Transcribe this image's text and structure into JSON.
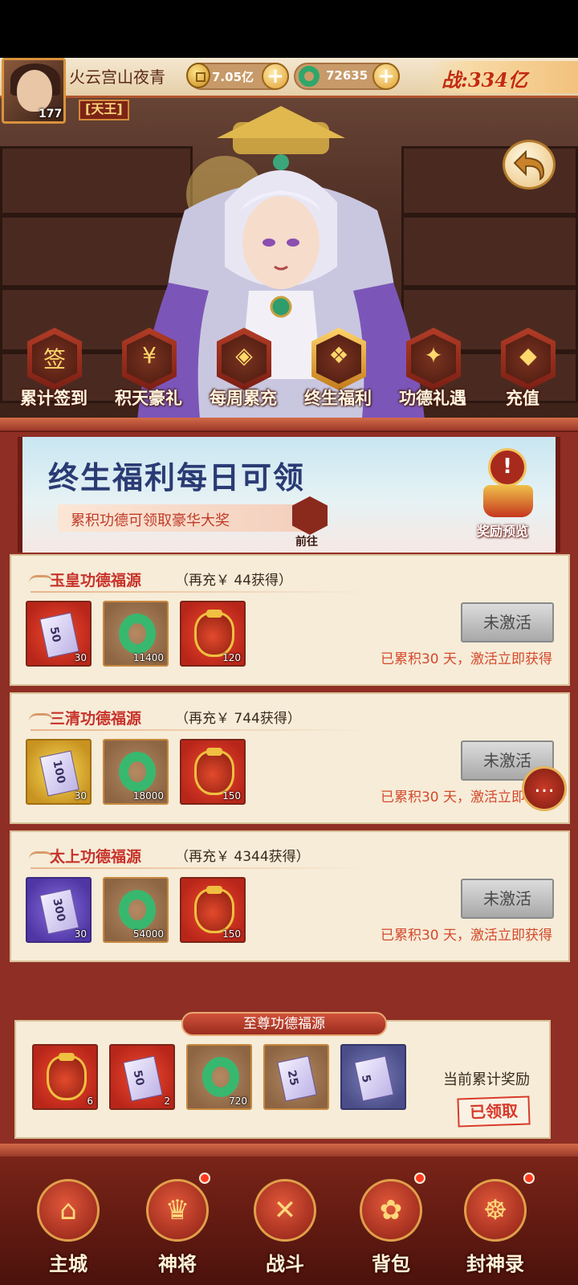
{
  "player": {
    "name": "火云宫山夜青",
    "level": "177",
    "title": "[天王]",
    "gold": "7.05亿",
    "jade": "72635",
    "power": "战:334亿"
  },
  "tabs": [
    {
      "label": "累计签到",
      "icon": "scroll-icon",
      "glyph": "签"
    },
    {
      "label": "积天豪礼",
      "icon": "coins-icon",
      "glyph": "¥"
    },
    {
      "label": "每周累充",
      "icon": "treasure-icon",
      "glyph": "◈"
    },
    {
      "label": "终生福利",
      "icon": "giftbox-icon",
      "glyph": "❖",
      "active": true
    },
    {
      "label": "功德礼遇",
      "icon": "gift-icon",
      "glyph": "✦"
    },
    {
      "label": "充值",
      "icon": "ingot-icon",
      "glyph": "◆"
    }
  ],
  "banner": {
    "title": "终生福利每日可领",
    "subtitle": "累积功德可领取豪华大奖",
    "go_label": "前往",
    "preview_label": "奖励预览"
  },
  "cards": [
    {
      "title": "玉皇功德福源",
      "note": "（再充￥ 44获得）",
      "items": [
        {
          "icon": "voucher-50-icon",
          "face": "50",
          "count": "30"
        },
        {
          "icon": "jade-ring-icon",
          "count": "11400"
        },
        {
          "icon": "red-purse-icon",
          "count": "120"
        }
      ],
      "button": "未激活",
      "status": "已累积30 天，激活立即获得"
    },
    {
      "title": "三清功德福源",
      "note": "（再充￥ 744获得）",
      "items": [
        {
          "icon": "voucher-100-icon",
          "face": "100",
          "count": "30"
        },
        {
          "icon": "jade-ring-icon",
          "count": "18000"
        },
        {
          "icon": "red-purse-icon",
          "count": "150"
        }
      ],
      "button": "未激活",
      "status": "已累积30 天，激活立即获得"
    },
    {
      "title": "太上功德福源",
      "note": "（再充￥ 4344获得）",
      "items": [
        {
          "icon": "voucher-300-icon",
          "face": "300",
          "count": "30"
        },
        {
          "icon": "jade-ring-icon",
          "count": "54000"
        },
        {
          "icon": "red-purse-icon",
          "count": "150"
        }
      ],
      "button": "未激活",
      "status": "已累积30 天，激活立即获得"
    }
  ],
  "supreme": {
    "title": "至尊功德福源",
    "items": [
      {
        "icon": "red-purse-icon",
        "count": "6"
      },
      {
        "icon": "voucher-50-icon",
        "face": "50",
        "count": "2"
      },
      {
        "icon": "jade-ring-icon",
        "count": "720"
      },
      {
        "icon": "voucher-25-icon",
        "face": "25",
        "count": ""
      },
      {
        "icon": "voucher-5-icon",
        "face": "5",
        "count": ""
      }
    ],
    "current_label": "当前累计奖励",
    "claimed_label": "已领取"
  },
  "nav": [
    {
      "label": "主城",
      "icon": "palace-icon",
      "glyph": "⌂"
    },
    {
      "label": "神将",
      "icon": "hero-icon",
      "glyph": "♛"
    },
    {
      "label": "战斗",
      "icon": "crossed-swords-icon",
      "glyph": "✕"
    },
    {
      "label": "背包",
      "icon": "bag-icon",
      "glyph": "✿"
    },
    {
      "label": "封神录",
      "icon": "lamp-icon",
      "glyph": "☸"
    }
  ]
}
